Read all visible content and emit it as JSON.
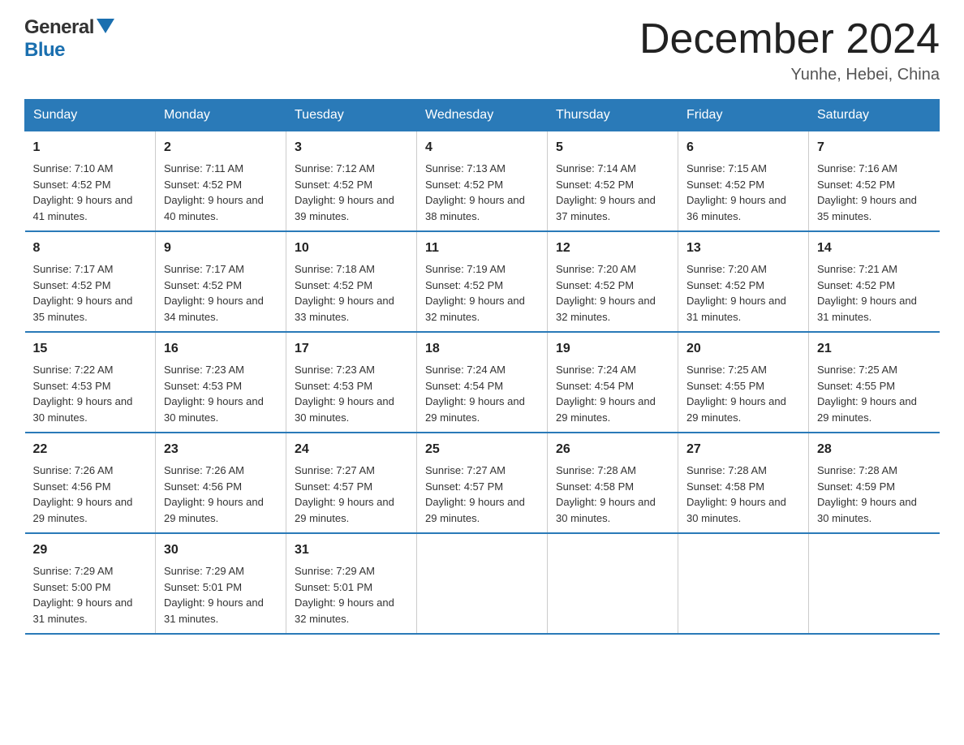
{
  "header": {
    "logo_general": "General",
    "logo_blue": "Blue",
    "month_title": "December 2024",
    "location": "Yunhe, Hebei, China"
  },
  "days_of_week": [
    "Sunday",
    "Monday",
    "Tuesday",
    "Wednesday",
    "Thursday",
    "Friday",
    "Saturday"
  ],
  "weeks": [
    [
      {
        "day": "1",
        "sunrise": "7:10 AM",
        "sunset": "4:52 PM",
        "daylight": "9 hours and 41 minutes."
      },
      {
        "day": "2",
        "sunrise": "7:11 AM",
        "sunset": "4:52 PM",
        "daylight": "9 hours and 40 minutes."
      },
      {
        "day": "3",
        "sunrise": "7:12 AM",
        "sunset": "4:52 PM",
        "daylight": "9 hours and 39 minutes."
      },
      {
        "day": "4",
        "sunrise": "7:13 AM",
        "sunset": "4:52 PM",
        "daylight": "9 hours and 38 minutes."
      },
      {
        "day": "5",
        "sunrise": "7:14 AM",
        "sunset": "4:52 PM",
        "daylight": "9 hours and 37 minutes."
      },
      {
        "day": "6",
        "sunrise": "7:15 AM",
        "sunset": "4:52 PM",
        "daylight": "9 hours and 36 minutes."
      },
      {
        "day": "7",
        "sunrise": "7:16 AM",
        "sunset": "4:52 PM",
        "daylight": "9 hours and 35 minutes."
      }
    ],
    [
      {
        "day": "8",
        "sunrise": "7:17 AM",
        "sunset": "4:52 PM",
        "daylight": "9 hours and 35 minutes."
      },
      {
        "day": "9",
        "sunrise": "7:17 AM",
        "sunset": "4:52 PM",
        "daylight": "9 hours and 34 minutes."
      },
      {
        "day": "10",
        "sunrise": "7:18 AM",
        "sunset": "4:52 PM",
        "daylight": "9 hours and 33 minutes."
      },
      {
        "day": "11",
        "sunrise": "7:19 AM",
        "sunset": "4:52 PM",
        "daylight": "9 hours and 32 minutes."
      },
      {
        "day": "12",
        "sunrise": "7:20 AM",
        "sunset": "4:52 PM",
        "daylight": "9 hours and 32 minutes."
      },
      {
        "day": "13",
        "sunrise": "7:20 AM",
        "sunset": "4:52 PM",
        "daylight": "9 hours and 31 minutes."
      },
      {
        "day": "14",
        "sunrise": "7:21 AM",
        "sunset": "4:52 PM",
        "daylight": "9 hours and 31 minutes."
      }
    ],
    [
      {
        "day": "15",
        "sunrise": "7:22 AM",
        "sunset": "4:53 PM",
        "daylight": "9 hours and 30 minutes."
      },
      {
        "day": "16",
        "sunrise": "7:23 AM",
        "sunset": "4:53 PM",
        "daylight": "9 hours and 30 minutes."
      },
      {
        "day": "17",
        "sunrise": "7:23 AM",
        "sunset": "4:53 PM",
        "daylight": "9 hours and 30 minutes."
      },
      {
        "day": "18",
        "sunrise": "7:24 AM",
        "sunset": "4:54 PM",
        "daylight": "9 hours and 29 minutes."
      },
      {
        "day": "19",
        "sunrise": "7:24 AM",
        "sunset": "4:54 PM",
        "daylight": "9 hours and 29 minutes."
      },
      {
        "day": "20",
        "sunrise": "7:25 AM",
        "sunset": "4:55 PM",
        "daylight": "9 hours and 29 minutes."
      },
      {
        "day": "21",
        "sunrise": "7:25 AM",
        "sunset": "4:55 PM",
        "daylight": "9 hours and 29 minutes."
      }
    ],
    [
      {
        "day": "22",
        "sunrise": "7:26 AM",
        "sunset": "4:56 PM",
        "daylight": "9 hours and 29 minutes."
      },
      {
        "day": "23",
        "sunrise": "7:26 AM",
        "sunset": "4:56 PM",
        "daylight": "9 hours and 29 minutes."
      },
      {
        "day": "24",
        "sunrise": "7:27 AM",
        "sunset": "4:57 PM",
        "daylight": "9 hours and 29 minutes."
      },
      {
        "day": "25",
        "sunrise": "7:27 AM",
        "sunset": "4:57 PM",
        "daylight": "9 hours and 29 minutes."
      },
      {
        "day": "26",
        "sunrise": "7:28 AM",
        "sunset": "4:58 PM",
        "daylight": "9 hours and 30 minutes."
      },
      {
        "day": "27",
        "sunrise": "7:28 AM",
        "sunset": "4:58 PM",
        "daylight": "9 hours and 30 minutes."
      },
      {
        "day": "28",
        "sunrise": "7:28 AM",
        "sunset": "4:59 PM",
        "daylight": "9 hours and 30 minutes."
      }
    ],
    [
      {
        "day": "29",
        "sunrise": "7:29 AM",
        "sunset": "5:00 PM",
        "daylight": "9 hours and 31 minutes."
      },
      {
        "day": "30",
        "sunrise": "7:29 AM",
        "sunset": "5:01 PM",
        "daylight": "9 hours and 31 minutes."
      },
      {
        "day": "31",
        "sunrise": "7:29 AM",
        "sunset": "5:01 PM",
        "daylight": "9 hours and 32 minutes."
      },
      null,
      null,
      null,
      null
    ]
  ],
  "labels": {
    "sunrise": "Sunrise:",
    "sunset": "Sunset:",
    "daylight": "Daylight:"
  }
}
